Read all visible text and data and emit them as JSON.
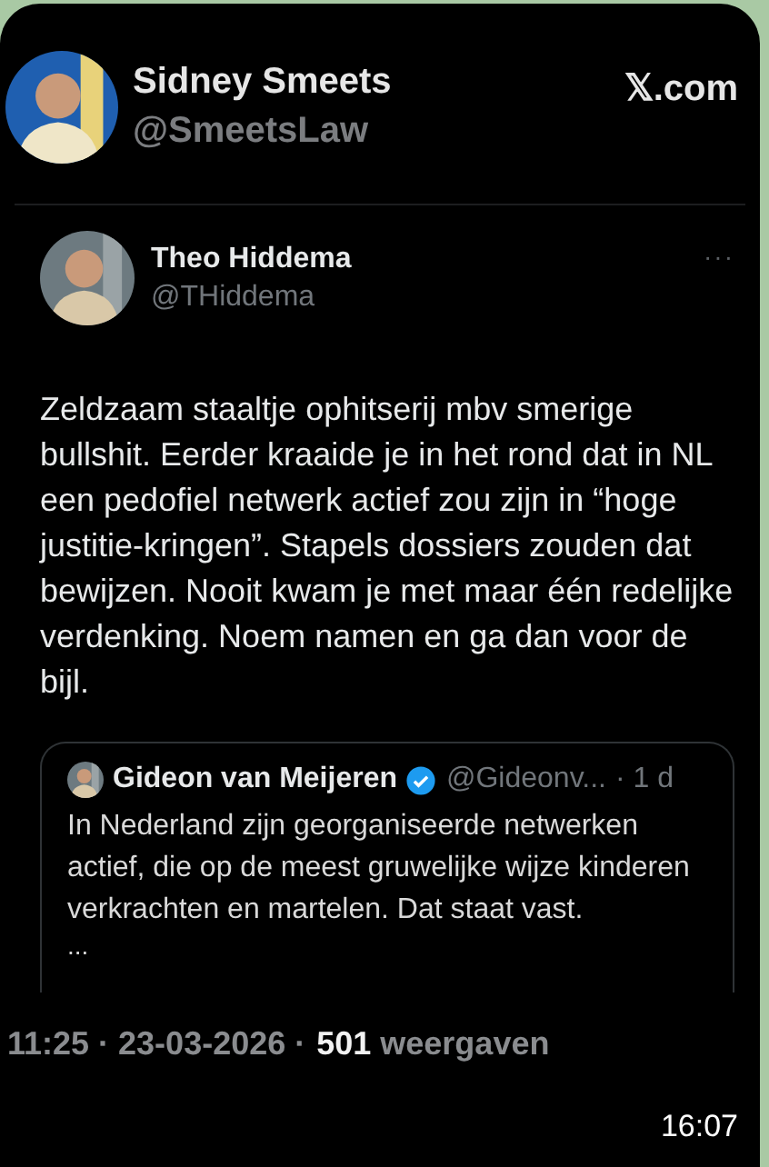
{
  "post": {
    "author": {
      "name": "Sidney Smeets",
      "handle": "@SmeetsLaw"
    },
    "source": "𝕏.com"
  },
  "tweet": {
    "author": {
      "name": "Theo Hiddema",
      "handle": "@THiddema"
    },
    "more": "···",
    "body": "Zeldzaam staaltje ophitserij mbv smerige bullshit. Eerder kraaide je in het rond dat in NL een pedofiel netwerk actief zou zijn in “hoge justitie-kringen”. Stapels dossiers zouden dat bewijzen. Nooit kwam je met maar één redelijke verdenking. Noem namen en ga dan voor de bijl.",
    "quote": {
      "name": "Gideon van Meijeren",
      "verified": true,
      "handle": "@Gideonv...",
      "time": "· 1 d",
      "body": "In Nederland zijn georganiseerde netwerken actief, die op de meest gruwelijke wijze kinderen verkrachten en martelen. Dat staat vast.",
      "ellipsis": "..."
    },
    "footer": {
      "time": "11:25 · 23-03-2026 ·",
      "views": "501",
      "views_label": "weergaven"
    }
  },
  "message_time": "16:07"
}
